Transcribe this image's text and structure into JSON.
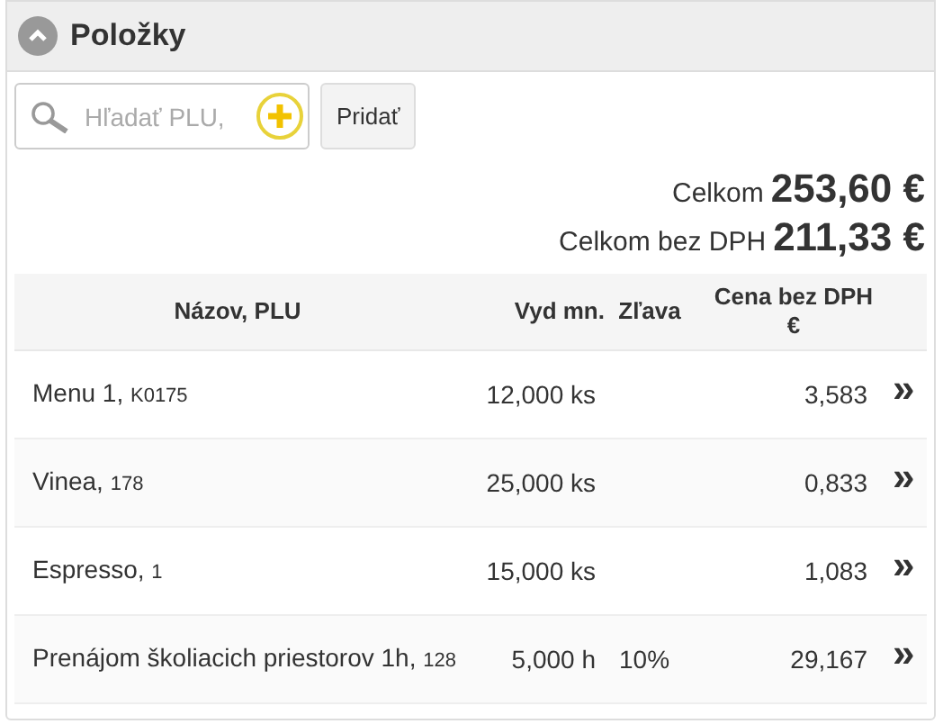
{
  "panel": {
    "title": "Položky",
    "expanded": true
  },
  "search": {
    "placeholder": "Hľadať PLU,"
  },
  "add_button": "Pridať",
  "totals": [
    {
      "label": "Celkom",
      "value": "253,60 €"
    },
    {
      "label": "Celkom bez DPH",
      "value": "211,33 €"
    }
  ],
  "table": {
    "columns": [
      "Názov, PLU",
      "Vyd mn.",
      "Zľava",
      "Cena bez DPH €"
    ],
    "rows": [
      {
        "name": "Menu 1,",
        "plu": "K0175",
        "quantity": "12,000 ks",
        "price": "3,583",
        "action": "»"
      },
      {
        "name": "Vinea,",
        "plu": "178",
        "quantity": "25,000 ks",
        "price": "0,833",
        "action": "»"
      },
      {
        "name": "Espresso,",
        "plu": "1",
        "quantity": "15,000 ks",
        "price": "1,083",
        "action": "»"
      },
      {
        "name": "Prenájom školiacich priestorov 1h,",
        "plu": "128",
        "quantity": "5,000 h",
        "discount": "10%",
        "price": "29,167",
        "action": "»"
      }
    ]
  }
}
